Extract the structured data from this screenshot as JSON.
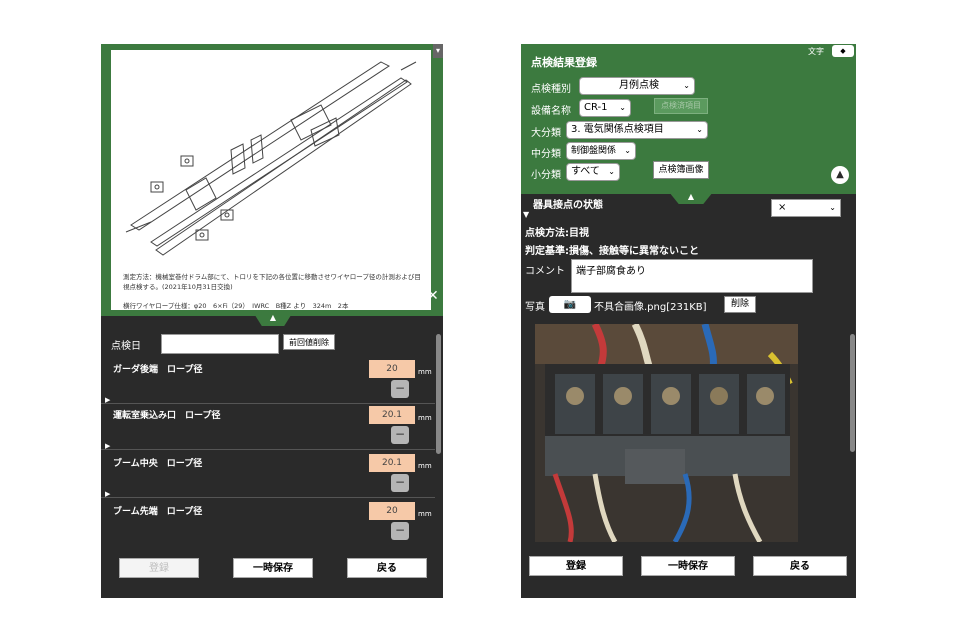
{
  "left": {
    "diagram_note": "測定方法：機械室巻付ドラム部にて、トロリを下記の各位置に移動させワイヤロープ径の計測および目視点検する。(2021年10月31日交換)",
    "diagram_spec": "横行ワイヤロープ仕様：φ20　6×Fi（29）　IWRC　B種Z より　324m　2本",
    "tab_icon": "▲",
    "date_label": "点検日",
    "date_value": "",
    "clear_button": "前回値削除",
    "items": [
      {
        "name": "ガーダ後端　ロープ径",
        "value": "20",
        "unit": "mm",
        "minus": "−",
        "arrow": "▶"
      },
      {
        "name": "運転室乗込み口　ロープ径",
        "value": "20.1",
        "unit": "mm",
        "minus": "−",
        "arrow": "▶"
      },
      {
        "name": "ブーム中央　ロープ径",
        "value": "20.1",
        "unit": "mm",
        "minus": "−",
        "arrow": "▶"
      },
      {
        "name": "ブーム先端　ロープ径",
        "value": "20",
        "unit": "mm",
        "minus": "−",
        "arrow": "▶"
      }
    ],
    "buttons": {
      "register": "登録",
      "temp_save": "一時保存",
      "back": "戻る"
    }
  },
  "right": {
    "title": "点検結果登録",
    "font_label": "文字",
    "font_select": "◆",
    "inspection_type_label": "点検種別",
    "inspection_type_value": "月例点検",
    "equipment_label": "設備名称",
    "equipment_value": "CR-1",
    "list_button": "点検済項目",
    "major_label": "大分類",
    "major_value": "3. 電気関係点検項目",
    "middle_label": "中分類",
    "middle_value": "制御盤関係",
    "minor_label": "小分類",
    "minor_value": "すべて",
    "image_button": "点検簿画像",
    "collapse_icon": "▲",
    "tab_icon": "▲",
    "section_title": "器具接点の状態",
    "section_arrow": "▼",
    "status_value": "×",
    "method": "点検方法:目視",
    "criteria": "判定基準:損傷、接触等に異常ないこと",
    "comment_label": "コメント",
    "comment_value": "端子部腐食あり",
    "photo_label": "写真",
    "camera_icon": "📷",
    "photo_filename": "不具合画像.png[231KB]",
    "delete_button": "削除",
    "buttons": {
      "register": "登録",
      "temp_save": "一時保存",
      "back": "戻る"
    }
  },
  "colors": {
    "green": "#3c7a3f",
    "dark": "#2a2a2a",
    "input_highlight": "#f6c9a8"
  }
}
